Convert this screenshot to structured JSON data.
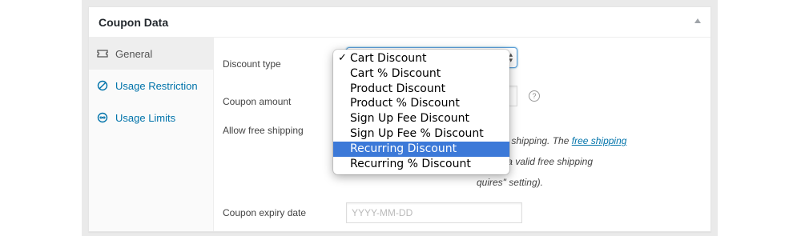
{
  "metabox": {
    "title": "Coupon Data"
  },
  "tabs": [
    {
      "label": "General",
      "icon": "ticket-icon",
      "active": true
    },
    {
      "label": "Usage Restriction",
      "icon": "no-entry-icon",
      "active": false
    },
    {
      "label": "Usage Limits",
      "icon": "infinity-icon",
      "active": false
    }
  ],
  "fields": {
    "discount_type": {
      "label": "Discount type",
      "value": "Cart Discount"
    },
    "coupon_amount": {
      "label": "Coupon amount"
    },
    "free_shipping": {
      "label": "Allow free shipping",
      "desc_part1": "nts free shipping. The ",
      "desc_link": "free shipping",
      "desc_part2": "to require \"a valid free shipping",
      "desc_part3": "quires\" setting)."
    },
    "expiry": {
      "label": "Coupon expiry date",
      "placeholder": "YYYY-MM-DD"
    }
  },
  "dropdown": {
    "options": [
      {
        "label": "Cart Discount",
        "checked": true
      },
      {
        "label": "Cart % Discount"
      },
      {
        "label": "Product Discount"
      },
      {
        "label": "Product % Discount"
      },
      {
        "label": "Sign Up Fee Discount"
      },
      {
        "label": "Sign Up Fee % Discount"
      },
      {
        "label": "Recurring Discount",
        "highlighted": true
      },
      {
        "label": "Recurring % Discount"
      }
    ],
    "check_glyph": "✓"
  },
  "help_glyph": "?",
  "colors": {
    "link": "#0073aa",
    "highlight": "#3c79d8",
    "focus": "#5b9dd9"
  }
}
